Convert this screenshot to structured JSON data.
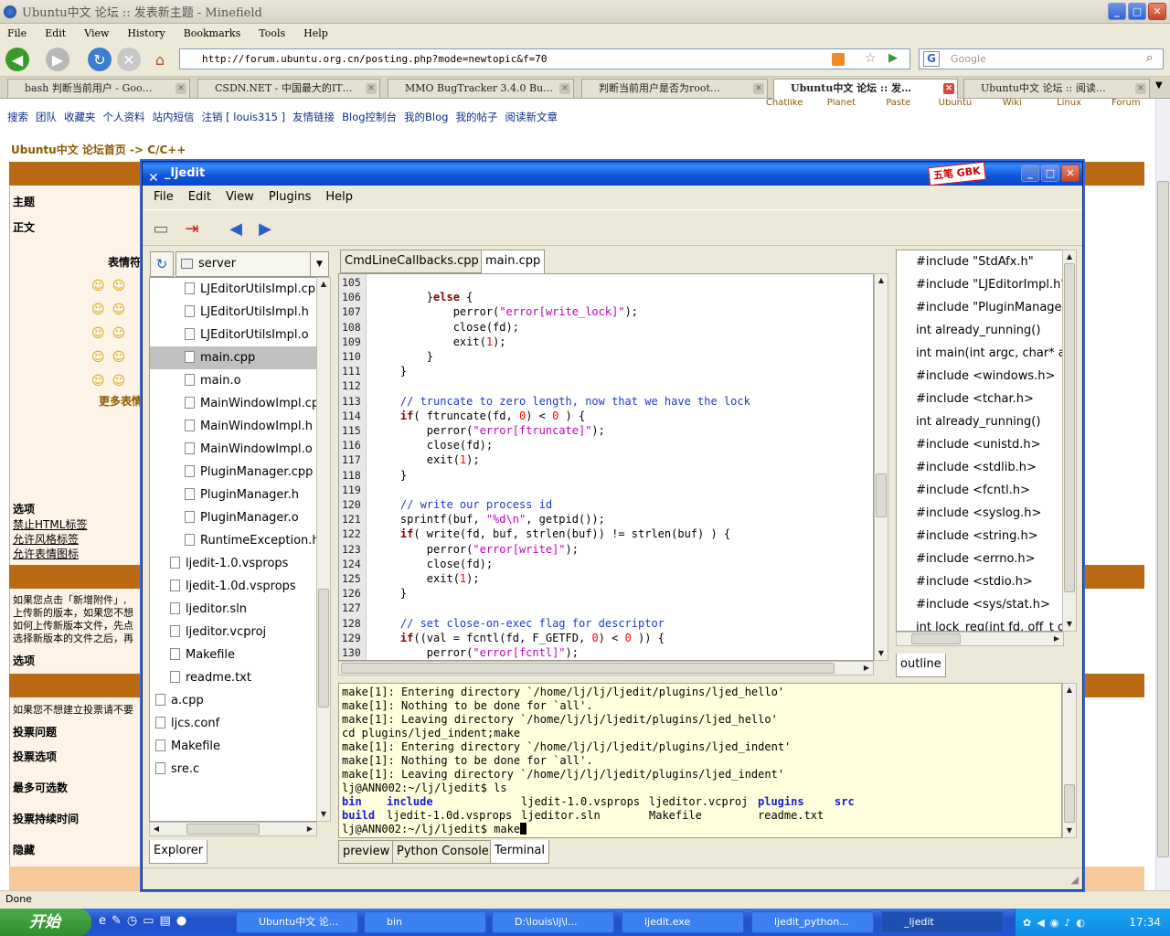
{
  "browser": {
    "title": "Ubuntu中文 论坛 :: 发表新主题 - Minefield",
    "menu": [
      "File",
      "Edit",
      "View",
      "History",
      "Bookmarks",
      "Tools",
      "Help"
    ],
    "url": "http://forum.ubuntu.org.cn/posting.php?mode=newtopic&f=70",
    "search_placeholder": "Google",
    "tabs": [
      {
        "label": "bash 判断当前用户 - Goo…",
        "active": false
      },
      {
        "label": "CSDN.NET - 中国最大的IT…",
        "active": false
      },
      {
        "label": "MMO BugTracker 3.4.0 Bu…",
        "active": false
      },
      {
        "label": "判断当前用户是否为root…",
        "active": false
      },
      {
        "label": "Ubuntu中文 论坛 :: 发…",
        "active": true
      },
      {
        "label": "Ubuntu中文 论坛 :: 阅读…",
        "active": false
      }
    ],
    "status": "Done"
  },
  "forum": {
    "links": [
      "搜索",
      "团队",
      "收藏夹",
      "个人资料",
      "站内短信",
      "注销 [ louis315 ]",
      "友情链接",
      "Blog控制台",
      "我的Blog",
      "我的帖子",
      "阅读新文章"
    ],
    "breadcrumb": "Ubuntu中文 论坛首页 -> C/C++",
    "labels": {
      "subject": "主题",
      "body": "正文",
      "emoticons": "表情符",
      "more_emoticons": "更多表情",
      "options": "选项",
      "opt1": "禁止HTML标签",
      "opt2": "允许风格标签",
      "opt3": "允许表情图标",
      "attach1": "如果您点击「新增附件」,",
      "attach2": "上传新的版本，如果您不想",
      "attach3": "如何上传新版本文件，先点",
      "attach4": "选择新版本的文件之后，再",
      "options2": "选项",
      "poll_note": "如果您不想建立投票请不要",
      "poll_q": "投票问题",
      "poll_opt": "投票选项",
      "max_opt": "最多可选数",
      "poll_dur": "投票持续时间",
      "hide": "隐藏"
    },
    "nav_tabs_partial": [
      "Chatlike",
      "Planet",
      "Paste",
      "Ubuntu",
      "Wiki",
      "Linux",
      "Forum"
    ]
  },
  "ljedit": {
    "title": "_ljedit",
    "badge": "五笔 GBK",
    "menu": [
      "File",
      "Edit",
      "View",
      "Plugins",
      "Help"
    ],
    "explorer": {
      "combo": "server",
      "tree": [
        {
          "label": "LJEditorUtilsImpl.cpp",
          "indent": 2,
          "selected": false
        },
        {
          "label": "LJEditorUtilsImpl.h",
          "indent": 2,
          "selected": false
        },
        {
          "label": "LJEditorUtilsImpl.o",
          "indent": 2,
          "selected": false
        },
        {
          "label": "main.cpp",
          "indent": 2,
          "selected": true
        },
        {
          "label": "main.o",
          "indent": 2,
          "selected": false
        },
        {
          "label": "MainWindowImpl.cpp",
          "indent": 2,
          "selected": false
        },
        {
          "label": "MainWindowImpl.h",
          "indent": 2,
          "selected": false
        },
        {
          "label": "MainWindowImpl.o",
          "indent": 2,
          "selected": false
        },
        {
          "label": "PluginManager.cpp",
          "indent": 2,
          "selected": false
        },
        {
          "label": "PluginManager.h",
          "indent": 2,
          "selected": false
        },
        {
          "label": "PluginManager.o",
          "indent": 2,
          "selected": false
        },
        {
          "label": "RuntimeException.h",
          "indent": 2,
          "selected": false
        },
        {
          "label": "ljedit-1.0.vsprops",
          "indent": 1,
          "selected": false
        },
        {
          "label": "ljedit-1.0d.vsprops",
          "indent": 1,
          "selected": false
        },
        {
          "label": "ljeditor.sln",
          "indent": 1,
          "selected": false
        },
        {
          "label": "ljeditor.vcproj",
          "indent": 1,
          "selected": false
        },
        {
          "label": "Makefile",
          "indent": 1,
          "selected": false
        },
        {
          "label": "readme.txt",
          "indent": 1,
          "selected": false
        },
        {
          "label": "a.cpp",
          "indent": 0,
          "selected": false
        },
        {
          "label": "ljcs.conf",
          "indent": 0,
          "selected": false
        },
        {
          "label": "Makefile",
          "indent": 0,
          "selected": false
        },
        {
          "label": "sre.c",
          "indent": 0,
          "selected": false
        }
      ],
      "tab": "Explorer"
    },
    "editor_tabs": [
      {
        "label": "CmdLineCallbacks.cpp",
        "active": false
      },
      {
        "label": "main.cpp",
        "active": true
      }
    ],
    "code": [
      {
        "n": "105",
        "html": ""
      },
      {
        "n": "106",
        "html": "        }<span class=\"kw\">else</span> {"
      },
      {
        "n": "107",
        "html": "            perror(<span class=\"str\">\"error[write_lock]\"</span>);"
      },
      {
        "n": "108",
        "html": "            close(fd);"
      },
      {
        "n": "109",
        "html": "            exit(<span class=\"num\">1</span>);"
      },
      {
        "n": "110",
        "html": "        }"
      },
      {
        "n": "111",
        "html": "    }"
      },
      {
        "n": "112",
        "html": ""
      },
      {
        "n": "113",
        "html": "    <span class=\"cm\">// truncate to zero length, now that we have the lock</span>"
      },
      {
        "n": "114",
        "html": "    <span class=\"kw\">if</span>( ftruncate(fd, <span class=\"num\">0</span>) &lt; <span class=\"num\">0</span> ) {"
      },
      {
        "n": "115",
        "html": "        perror(<span class=\"str\">\"error[ftruncate]\"</span>);"
      },
      {
        "n": "116",
        "html": "        close(fd);"
      },
      {
        "n": "117",
        "html": "        exit(<span class=\"num\">1</span>);"
      },
      {
        "n": "118",
        "html": "    }"
      },
      {
        "n": "119",
        "html": ""
      },
      {
        "n": "120",
        "html": "    <span class=\"cm\">// write our process id</span>"
      },
      {
        "n": "121",
        "html": "    sprintf(buf, <span class=\"str\">\"%d\\n\"</span>, getpid());"
      },
      {
        "n": "122",
        "html": "    <span class=\"kw\">if</span>( write(fd, buf, strlen(buf)) != strlen(buf) ) {"
      },
      {
        "n": "123",
        "html": "        perror(<span class=\"str\">\"error[write]\"</span>);"
      },
      {
        "n": "124",
        "html": "        close(fd);"
      },
      {
        "n": "125",
        "html": "        exit(<span class=\"num\">1</span>);"
      },
      {
        "n": "126",
        "html": "    }"
      },
      {
        "n": "127",
        "html": ""
      },
      {
        "n": "128",
        "html": "    <span class=\"cm\">// set close-on-exec flag for descriptor</span>"
      },
      {
        "n": "129",
        "html": "    <span class=\"kw\">if</span>((val = fcntl(fd, F_GETFD, <span class=\"num\">0</span>) &lt; <span class=\"num\">0</span> )) {"
      },
      {
        "n": "130",
        "html": "        perror(<span class=\"str\">\"error[fcntl]\"</span>);"
      }
    ],
    "outline": [
      "#include \"StdAfx.h\"",
      "#include \"LJEditorImpl.h\"",
      "#include \"PluginManager.h\"",
      "int already_running()",
      "int main(int argc, char* argv[])",
      "#include <windows.h>",
      "#include <tchar.h>",
      "int already_running()",
      "#include <unistd.h>",
      "#include <stdlib.h>",
      "#include <fcntl.h>",
      "#include <syslog.h>",
      "#include <string.h>",
      "#include <errno.h>",
      "#include <stdio.h>",
      "#include <sys/stat.h>",
      "int lock_reg(int fd, off_t offset)"
    ],
    "outline_tab": "outline",
    "terminal": [
      "make[1]: Entering directory `/home/lj/lj/ljedit/plugins/ljed_hello'",
      "make[1]: Nothing to be done for `all'.",
      "make[1]: Leaving directory `/home/lj/lj/ljedit/plugins/ljed_hello'",
      "cd plugins/ljed_indent;make",
      "make[1]: Entering directory `/home/lj/lj/ljedit/plugins/ljed_indent'",
      "make[1]: Nothing to be done for `all'.",
      "make[1]: Leaving directory `/home/lj/lj/ljedit/plugins/ljed_indent'",
      "lj@ANN002:~/lj/ljedit$ ls"
    ],
    "ls_row1": [
      {
        "t": "bin",
        "b": true
      },
      {
        "t": "include",
        "b": true
      },
      {
        "t": "ljedit-1.0.vsprops",
        "b": false
      },
      {
        "t": "ljeditor.vcproj",
        "b": false
      },
      {
        "t": "plugins",
        "b": true
      },
      {
        "t": "src",
        "b": true
      }
    ],
    "ls_row2": [
      {
        "t": "build",
        "b": true
      },
      {
        "t": "ljedit-1.0d.vsprops",
        "b": false
      },
      {
        "t": "ljeditor.sln",
        "b": false
      },
      {
        "t": "Makefile",
        "b": false
      },
      {
        "t": "readme.txt",
        "b": false
      }
    ],
    "prompt": "lj@ANN002:~/lj/ljedit$ make",
    "bottom_tabs": [
      {
        "label": "preview",
        "active": false
      },
      {
        "label": "Python Console",
        "active": false
      },
      {
        "label": "Terminal",
        "active": true
      }
    ]
  },
  "taskbar": {
    "start": "开始",
    "items": [
      {
        "label": "Ubuntu中文 论...",
        "active": false
      },
      {
        "label": "bin",
        "active": false
      },
      {
        "label": "D:\\louis\\lj\\l...",
        "active": false
      },
      {
        "label": "ljedit.exe",
        "active": false
      },
      {
        "label": "ljedit_python...",
        "active": false
      },
      {
        "label": "_ljedit",
        "active": true
      }
    ],
    "clock": "17:34"
  }
}
